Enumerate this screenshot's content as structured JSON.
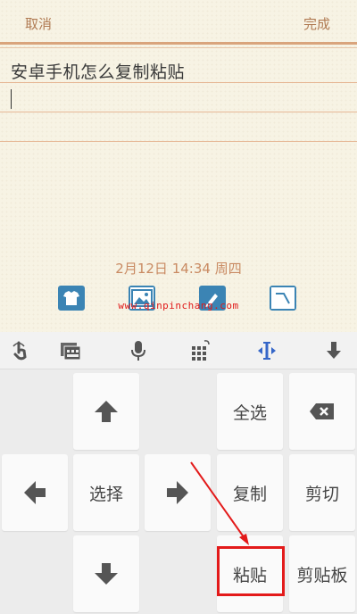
{
  "header": {
    "cancel_label": "取消",
    "done_label": "完成"
  },
  "note": {
    "title": "安卓手机怎么复制粘贴",
    "date": "2月12日 14:34 周四",
    "tools": [
      "shirt-icon",
      "image-icon",
      "pen-icon",
      "handwriting-icon"
    ]
  },
  "watermark": "www.qinpinchang.com",
  "keyboard_toolbar": {
    "icons": [
      "gesture-icon",
      "pinyin-keyboard-icon",
      "microphone-icon",
      "numpad-icon",
      "cursor-icon",
      "hide-keyboard-icon"
    ]
  },
  "keyboard": {
    "select_label": "选择",
    "select_all_label": "全选",
    "copy_label": "复制",
    "cut_label": "剪切",
    "paste_label": "粘贴",
    "clipboard_label": "剪贴板"
  },
  "colors": {
    "accent": "#b07a52",
    "tool_icon": "#3b84b4",
    "cursor_icon": "#3566c8",
    "highlight": "#e31a1a"
  }
}
